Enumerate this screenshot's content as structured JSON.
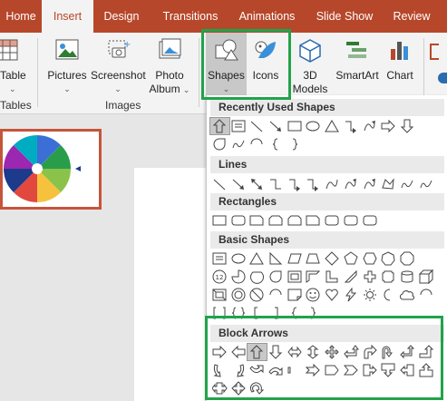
{
  "tabs": [
    {
      "label": "Home"
    },
    {
      "label": "Insert"
    },
    {
      "label": "Design"
    },
    {
      "label": "Transitions"
    },
    {
      "label": "Animations"
    },
    {
      "label": "Slide Show"
    },
    {
      "label": "Review"
    }
  ],
  "ribbon": {
    "table_label": "Table",
    "tables_group": "Tables",
    "pictures_label": "Pictures",
    "screenshot_label": "Screenshot",
    "photo_album_line1": "Photo",
    "photo_album_line2": "Album",
    "images_group": "Images",
    "shapes_label": "Shapes",
    "icons_label": "Icons",
    "models_line1": "3D",
    "models_line2": "Models",
    "smartart_label": "SmartArt",
    "chart_label": "Chart"
  },
  "gallery": {
    "sections": [
      "Recently Used Shapes",
      "Lines",
      "Rectangles",
      "Basic Shapes",
      "Block Arrows"
    ]
  },
  "icons": {
    "shapes": "shapes-icon",
    "icons": "icons-icon",
    "models": "cube-icon"
  },
  "colors": {
    "accent": "#b7472a",
    "highlight": "#21a34a",
    "selected": "#c8c8c8"
  }
}
